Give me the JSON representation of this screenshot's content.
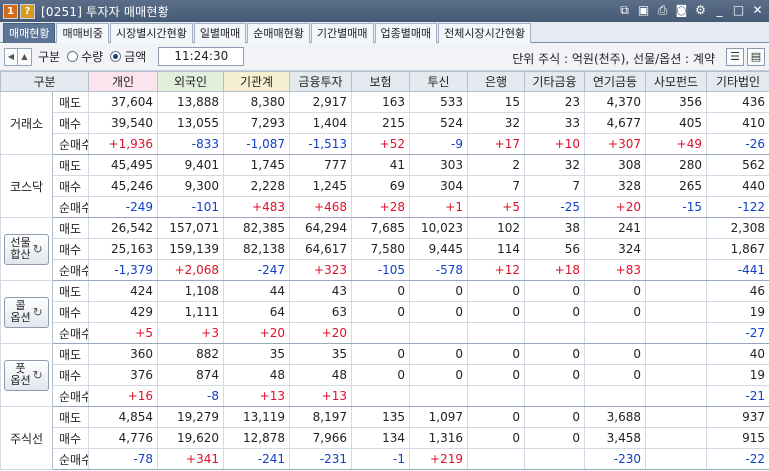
{
  "title_bar": {
    "badge1": "1",
    "badge2": "?",
    "title": "[0251] 투자자 매매현황"
  },
  "tabs": [
    {
      "label": "매매현황",
      "active": true
    },
    {
      "label": "매매비중",
      "active": false
    },
    {
      "label": "시장별시간현황",
      "active": false
    },
    {
      "label": "일별매매",
      "active": false
    },
    {
      "label": "순매매현황",
      "active": false
    },
    {
      "label": "기간별매매",
      "active": false
    },
    {
      "label": "업종별매매",
      "active": false
    },
    {
      "label": "전체시장시간현황",
      "active": false
    }
  ],
  "toolbar": {
    "label": "구분",
    "radio_quantity": "수량",
    "radio_amount": "금액",
    "selected": "amount",
    "time": "11:24:30",
    "unit_info": "단위 주식 : 억원(천주), 선물/옵션 : 계약"
  },
  "columns": [
    "구분",
    "개인",
    "외국인",
    "기관계",
    "금융투자",
    "보험",
    "투신",
    "은행",
    "기타금융",
    "연기금등",
    "사모펀드",
    "기타법인"
  ],
  "row_labels": {
    "sell": "매도",
    "buy": "매수",
    "net": "순매수"
  },
  "markets": [
    {
      "name": "거래소",
      "button": false,
      "sell": [
        "37,604",
        "13,888",
        "8,380",
        "2,917",
        "163",
        "533",
        "15",
        "23",
        "4,370",
        "356",
        "436"
      ],
      "buy": [
        "39,540",
        "13,055",
        "7,293",
        "1,404",
        "215",
        "524",
        "32",
        "33",
        "4,677",
        "405",
        "410"
      ],
      "net": [
        "+1,936",
        "-833",
        "-1,087",
        "-1,513",
        "+52",
        "-9",
        "+17",
        "+10",
        "+307",
        "+49",
        "-26"
      ]
    },
    {
      "name": "코스닥",
      "button": false,
      "sell": [
        "45,495",
        "9,401",
        "1,745",
        "777",
        "41",
        "303",
        "2",
        "32",
        "308",
        "280",
        "562"
      ],
      "buy": [
        "45,246",
        "9,300",
        "2,228",
        "1,245",
        "69",
        "304",
        "7",
        "7",
        "328",
        "265",
        "440"
      ],
      "net": [
        "-249",
        "-101",
        "+483",
        "+468",
        "+28",
        "+1",
        "+5",
        "-25",
        "+20",
        "-15",
        "-122"
      ]
    },
    {
      "name": "선물\n합산",
      "button": true,
      "sell": [
        "26,542",
        "157,071",
        "82,385",
        "64,294",
        "7,685",
        "10,023",
        "102",
        "38",
        "241",
        "",
        "2,308"
      ],
      "buy": [
        "25,163",
        "159,139",
        "82,138",
        "64,617",
        "7,580",
        "9,445",
        "114",
        "56",
        "324",
        "",
        "1,867"
      ],
      "net": [
        "-1,379",
        "+2,068",
        "-247",
        "+323",
        "-105",
        "-578",
        "+12",
        "+18",
        "+83",
        "",
        "-441"
      ]
    },
    {
      "name": "콜\n옵션",
      "button": true,
      "sell": [
        "424",
        "1,108",
        "44",
        "43",
        "0",
        "0",
        "0",
        "0",
        "0",
        "",
        "46"
      ],
      "buy": [
        "429",
        "1,111",
        "64",
        "63",
        "0",
        "0",
        "0",
        "0",
        "0",
        "",
        "19"
      ],
      "net": [
        "+5",
        "+3",
        "+20",
        "+20",
        "",
        "",
        "",
        "",
        "",
        "",
        "-27"
      ]
    },
    {
      "name": "풋\n옵션",
      "button": true,
      "sell": [
        "360",
        "882",
        "35",
        "35",
        "0",
        "0",
        "0",
        "0",
        "0",
        "",
        "40"
      ],
      "buy": [
        "376",
        "874",
        "48",
        "48",
        "0",
        "0",
        "0",
        "0",
        "0",
        "",
        "19"
      ],
      "net": [
        "+16",
        "-8",
        "+13",
        "+13",
        "",
        "",
        "",
        "",
        "",
        "",
        "-21"
      ]
    },
    {
      "name": "주식선",
      "button": false,
      "sell": [
        "4,854",
        "19,279",
        "13,119",
        "8,197",
        "135",
        "1,097",
        "0",
        "0",
        "3,688",
        "",
        "937"
      ],
      "buy": [
        "4,776",
        "19,620",
        "12,878",
        "7,966",
        "134",
        "1,316",
        "0",
        "0",
        "3,458",
        "",
        "915"
      ],
      "net": [
        "-78",
        "+341",
        "-241",
        "-231",
        "-1",
        "+219",
        "",
        "",
        "-230",
        "",
        "-22"
      ]
    }
  ],
  "colors": {
    "positive": "#e0102a",
    "negative": "#1140c9",
    "tab_active": "#5d7595"
  }
}
